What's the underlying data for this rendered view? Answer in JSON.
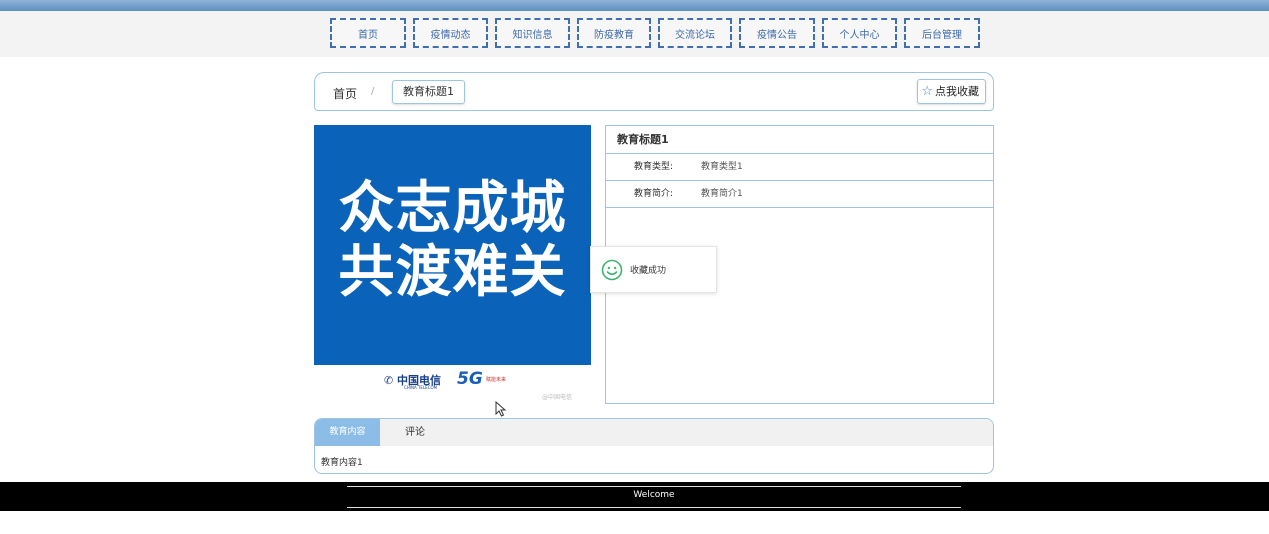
{
  "nav": {
    "items": [
      "首页",
      "疫情动态",
      "知识信息",
      "防疫教育",
      "交流论坛",
      "疫情公告",
      "个人中心",
      "后台管理"
    ]
  },
  "breadcrumb": {
    "home": "首页",
    "separator": "/",
    "current": "教育标题1"
  },
  "favorite_button": "点我收藏",
  "poster": {
    "line1": "众志成城",
    "line2": "共渡难关",
    "telecom": "中国电信",
    "telecom_sub": "CHINA TELECOM",
    "fiveg": "5G",
    "fiveg_sub": "赋能未来",
    "watermark": "@中国电信"
  },
  "detail": {
    "title": "教育标题1",
    "rows": [
      {
        "label": "教育类型:",
        "value": "教育类型1"
      },
      {
        "label": "教育简介:",
        "value": "教育简介1"
      }
    ]
  },
  "toast": {
    "message": "收藏成功"
  },
  "tabs": {
    "items": [
      "教育内容",
      "评论"
    ],
    "active": 0,
    "content": "教育内容1"
  },
  "footer": {
    "text": "Welcome"
  },
  "colors": {
    "accent": "#3f6fb0",
    "border": "#9ec4e2",
    "poster_bg": "#0a63b8",
    "toast_icon": "#3cb371"
  }
}
